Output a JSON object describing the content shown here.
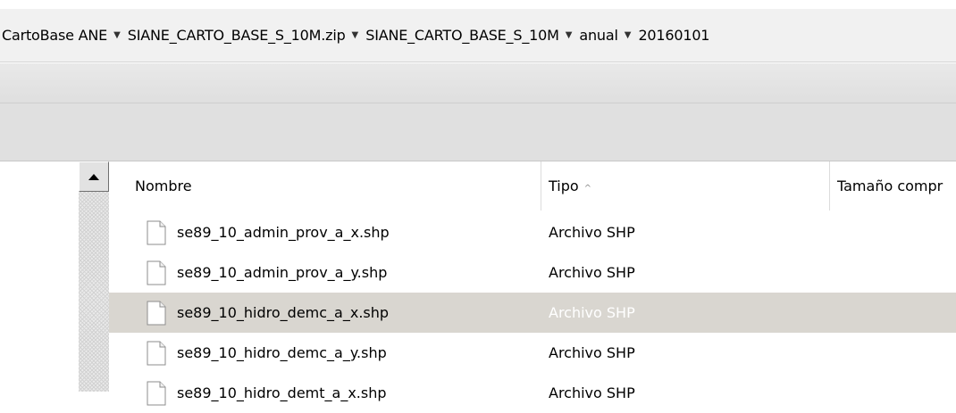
{
  "breadcrumbs": [
    "CartoBase ANE",
    "SIANE_CARTO_BASE_S_10M.zip",
    "SIANE_CARTO_BASE_S_10M",
    "anual",
    "20160101"
  ],
  "columns": {
    "name": "Nombre",
    "type": "Tipo",
    "size": "Tamaño compr"
  },
  "files": [
    {
      "name": "se89_10_admin_prov_a_x.shp",
      "type": "Archivo SHP"
    },
    {
      "name": "se89_10_admin_prov_a_y.shp",
      "type": "Archivo SHP"
    },
    {
      "name": "se89_10_hidro_demc_a_x.shp",
      "type": "Archivo SHP"
    },
    {
      "name": "se89_10_hidro_demc_a_y.shp",
      "type": "Archivo SHP"
    },
    {
      "name": "se89_10_hidro_demt_a_x.shp",
      "type": "Archivo SHP"
    }
  ],
  "selected_index": 2,
  "colors": {
    "selection": "#d9d6d0",
    "toolbar": "#e0e0e0"
  },
  "icons": {
    "file": "file-icon",
    "scroll_up": "arrow-up-icon",
    "sort": "sort-ascending-icon",
    "crumb": "chevron-down-icon"
  }
}
